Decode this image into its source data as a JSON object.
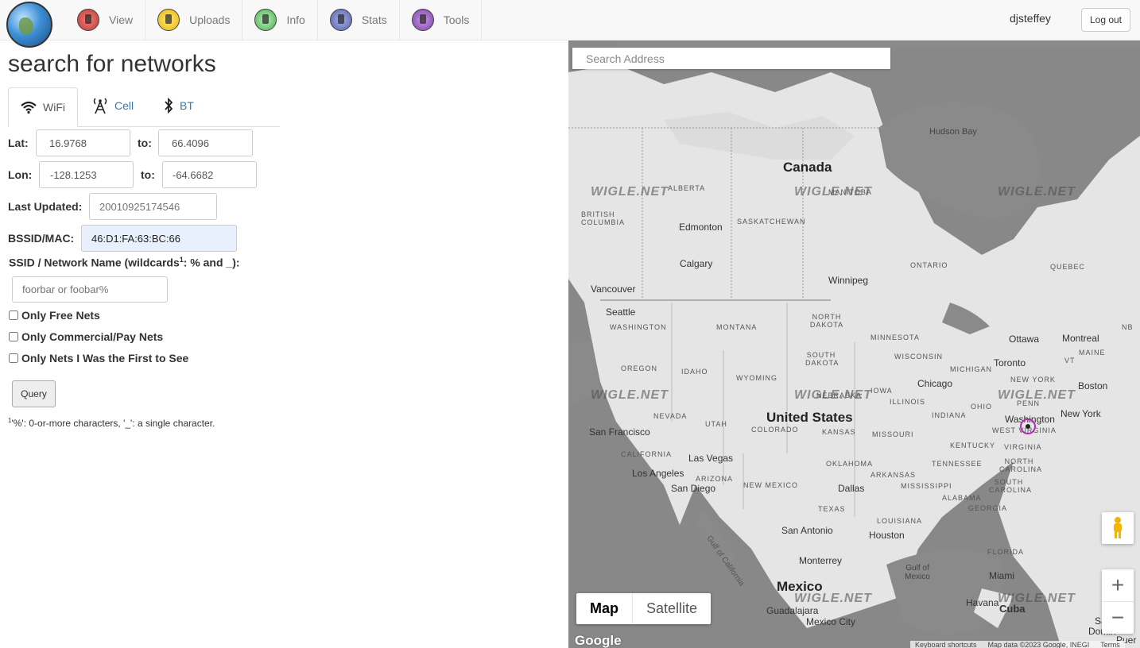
{
  "nav": {
    "items": [
      {
        "label": "View",
        "color": "#c0392b"
      },
      {
        "label": "Uploads",
        "color": "#e6b800"
      },
      {
        "label": "Info",
        "color": "#4caf50"
      },
      {
        "label": "Stats",
        "color": "#5560a8"
      },
      {
        "label": "Tools",
        "color": "#7e3fa8"
      }
    ],
    "user": "djsteffey",
    "logout_label": "Log out"
  },
  "page_title": "search for networks",
  "tabs": [
    {
      "label": "WiFi",
      "icon": "wifi-icon",
      "active": true
    },
    {
      "label": "Cell",
      "icon": "cell-tower-icon",
      "active": false
    },
    {
      "label": "BT",
      "icon": "bluetooth-icon",
      "active": false
    }
  ],
  "form": {
    "lat_label": "Lat:",
    "lat_from": "16.9768",
    "lat_to_label": "to:",
    "lat_to": "66.4096",
    "lon_label": "Lon:",
    "lon_from": "-128.1253",
    "lon_to_label": "to:",
    "lon_to": "-64.6682",
    "last_updated_label": "Last Updated:",
    "last_updated_placeholder": "20010925174546",
    "bssid_label": "BSSID/MAC:",
    "bssid_value": "46:D1:FA:63:BC:66",
    "ssid_label_pre": "SSID / Network Name (wildcards",
    "ssid_label_sup": "1",
    "ssid_label_post": ": % and _):",
    "ssid_placeholder": "foorbar or foobar%",
    "checkboxes": [
      "Only Free Nets",
      "Only Commercial/Pay Nets",
      "Only Nets I Was the First to See"
    ],
    "query_label": "Query",
    "footnote_sup": "1",
    "footnote": "'%': 0-or-more characters, '_': a single character."
  },
  "map": {
    "search_placeholder": "Search Address",
    "map_label": "Map",
    "satellite_label": "Satellite",
    "zoom_in": "+",
    "zoom_out": "−",
    "google": "Google",
    "attribution": [
      "Keyboard shortcuts",
      "Map data ©2023 Google, INEGI",
      "Terms"
    ],
    "watermark": "WIGLE.NET",
    "country_labels": [
      "Canada",
      "United States",
      "Mexico"
    ],
    "water_labels": [
      "Hudson Bay",
      "Gulf of Mexico",
      "Gulf of California"
    ],
    "region_labels": [
      "ALBERTA",
      "BRITISH COLUMBIA",
      "SASKATCHEWAN",
      "MANITOBA",
      "ONTARIO",
      "QUEBEC",
      "NB",
      "NORTH DAKOTA",
      "MONTANA",
      "WASHINGTON",
      "OREGON",
      "IDAHO",
      "WYOMING",
      "SOUTH DAKOTA",
      "MINNESOTA",
      "WISCONSIN",
      "MICHIGAN",
      "NEW YORK",
      "VT",
      "MAINE",
      "NEBRASKA",
      "IOWA",
      "ILLINOIS",
      "INDIANA",
      "OHIO",
      "PENN",
      "NEVADA",
      "UTAH",
      "COLORADO",
      "KANSAS",
      "MISSOURI",
      "KENTUCKY",
      "VIRGINIA",
      "WEST VIRGINIA",
      "CALIFORNIA",
      "ARIZONA",
      "NEW MEXICO",
      "OKLAHOMA",
      "ARKANSAS",
      "TENNESSEE",
      "NORTH CAROLINA",
      "SOUTH CAROLINA",
      "TEXAS",
      "LOUISIANA",
      "MISSISSIPPI",
      "ALABAMA",
      "GEORGIA",
      "FLORIDA"
    ],
    "city_labels": [
      "Edmonton",
      "Calgary",
      "Vancouver",
      "Seattle",
      "Winnipeg",
      "Ottawa",
      "Montreal",
      "Toronto",
      "Chicago",
      "Boston",
      "New York",
      "Washington",
      "San Francisco",
      "Las Vegas",
      "Los Angeles",
      "San Diego",
      "Dallas",
      "San Antonio",
      "Houston",
      "Monterrey",
      "Miami",
      "Havana",
      "Cuba",
      "Guadalajara",
      "Mexico City",
      "Sant",
      "Domin",
      "Puer"
    ]
  }
}
